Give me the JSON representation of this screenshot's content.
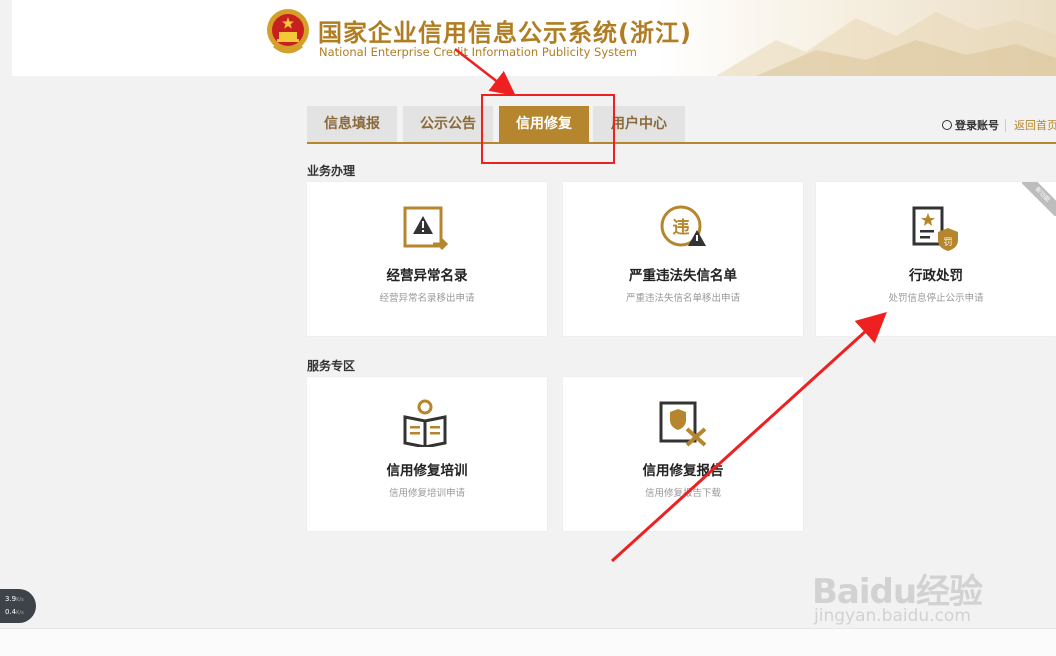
{
  "header": {
    "title_cn": "国家企业信用信息公示系统(浙江)",
    "title_en": "National Enterprise Credit Information Publicity System"
  },
  "nav": {
    "tabs": [
      {
        "label": "信息填报",
        "active": false
      },
      {
        "label": "公示公告",
        "active": false
      },
      {
        "label": "信用修复",
        "active": true
      },
      {
        "label": "用户中心",
        "active": false
      }
    ],
    "login_label": "登录账号",
    "back_label": "返回首页"
  },
  "sections": [
    {
      "title": "业务办理",
      "cards": [
        {
          "icon": "warning-document-icon",
          "title": "经营异常名录",
          "subtitle": "经营异常名录移出申请"
        },
        {
          "icon": "violation-badge-icon",
          "title": "严重违法失信名单",
          "subtitle": "严重违法失信名单移出申请"
        },
        {
          "icon": "penalty-document-icon",
          "title": "行政处罚",
          "subtitle": "处罚信息停止公示申请",
          "corner_label": "新功能"
        }
      ]
    },
    {
      "title": "服务专区",
      "cards": [
        {
          "icon": "training-book-icon",
          "title": "信用修复培训",
          "subtitle": "信用修复培训申请"
        },
        {
          "icon": "report-tools-icon",
          "title": "信用修复报告",
          "subtitle": "信用修复报告下载"
        }
      ]
    }
  ],
  "status_widget": {
    "upload": "3.9",
    "download": "0.4",
    "unit": "K/s"
  },
  "watermark": {
    "logo": "Baidu经验",
    "url": "jingyan.baidu.com"
  },
  "colors": {
    "accent": "#b5862d",
    "annotation": "#ee2020",
    "title": "#b07d22"
  }
}
